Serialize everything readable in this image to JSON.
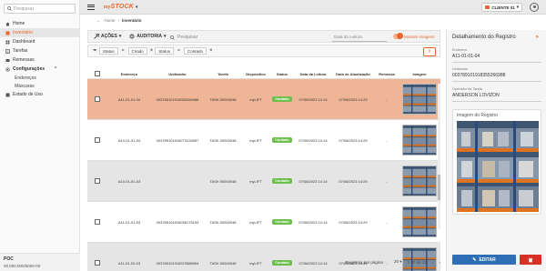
{
  "sidebar": {
    "search_placeholder": "Pesquisar",
    "items": [
      {
        "label": "Home"
      },
      {
        "label": "Inventário"
      },
      {
        "label": "Dashboard"
      },
      {
        "label": "Tarefas"
      },
      {
        "label": "Remessas"
      }
    ],
    "config_label": "Configurações",
    "sub_items": [
      "Endereços",
      "Máscaras"
    ],
    "extra_item": "Estado de Uso",
    "footer_org": "POC",
    "footer_cnpj": "00.000.000/0000-00"
  },
  "topbar": {
    "logo_prefix": "my",
    "logo_main": "STOCK",
    "client_label": "CLIENTE 01"
  },
  "breadcrumb": {
    "home": "Home",
    "current": "Inventário"
  },
  "toolbar": {
    "actions_label": "AÇÕES",
    "audit_label": "AUDITORIA",
    "search_placeholder": "Pesquisar",
    "date_placeholder": "Data da Leitura",
    "toggle_label": "Mostrar imagens"
  },
  "filters": {
    "chips": [
      {
        "field": "Status",
        "op": "=",
        "value": "Criado"
      },
      {
        "field": "Status",
        "op": "=",
        "value": "Contado"
      }
    ]
  },
  "table": {
    "columns": [
      "Endereço",
      "Unitizador",
      "Tarefa",
      "Dispositivo",
      "Status",
      "Data da Leitura",
      "Data de Atualização",
      "Remessa",
      "Imagem"
    ],
    "rows": [
      {
        "endereco": "A11-01-01-04",
        "unitizador": "003789101918355266988",
        "tarefa": "TASK 00000048",
        "dispositivo": "myLIFT",
        "status": "Contado",
        "data_leitura": "07/08/2023 14:14",
        "data_atualizacao": "07/08/2023 14:29",
        "remessa": "-"
      },
      {
        "endereco": "A10-01-01-04",
        "unitizador": "003789101918273134997",
        "tarefa": "TASK 00000048",
        "dispositivo": "myLIFT",
        "status": "Contado",
        "data_leitura": "07/08/2023 14:14",
        "data_atualizacao": "07/08/2023 14:29",
        "remessa": "-"
      },
      {
        "endereco": "A10-01-01-03",
        "unitizador": "",
        "tarefa": "TASK 00000048",
        "dispositivo": "myLIFT",
        "status": "Contado",
        "data_leitura": "07/08/2023 14:14",
        "data_atualizacao": "07/08/2023 14:29",
        "remessa": "-"
      },
      {
        "endereco": "A11-01-01-03",
        "unitizador": "003789101918298175194",
        "tarefa": "TASK 00000048",
        "dispositivo": "myLIFT",
        "status": "Contado",
        "data_leitura": "07/08/2023 14:14",
        "data_atualizacao": "07/08/2023 14:29",
        "remessa": "-"
      },
      {
        "endereco": "A11-01-02-03",
        "unitizador": "003789101918370586994",
        "tarefa": "TASK 00000048",
        "dispositivo": "myLIFT",
        "status": "Contado",
        "data_leitura": "07/08/2023 14:14",
        "data_atualizacao": "07/08/2023 14:29",
        "remessa": "-"
      }
    ]
  },
  "pager": {
    "per_page_label": "Registros por página",
    "per_page": "20",
    "range": "1-20 de 22"
  },
  "panel": {
    "title": "Detalhamento do Registro",
    "endereco_label": "Endereço",
    "endereco_value": "A11-01-01-04",
    "unitizador_label": "Unitizador",
    "unitizador_value": "003789101918355266988",
    "operador_label": "Operador da Tarefa",
    "operador_value": "ANDERSON LOVIZON",
    "image_label": "Imagem do Registro",
    "edit_label": "EDITAR"
  },
  "colors": {
    "accent": "#e8662a",
    "selected_row": "#efb597",
    "status_green": "#6cbf4b",
    "edit_blue": "#2f6fb5",
    "delete_red": "#d93025"
  }
}
